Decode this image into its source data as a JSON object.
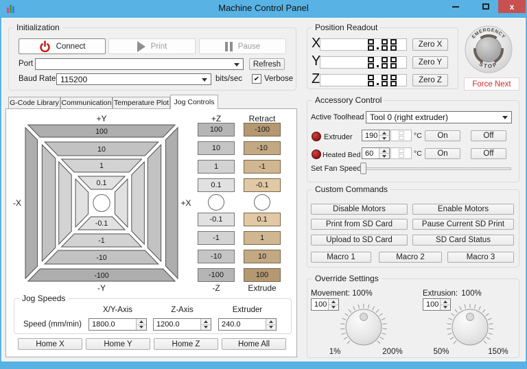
{
  "window": {
    "title": "Machine Control Panel",
    "close_glyph": "x"
  },
  "init": {
    "title": "Initialization",
    "connect": "Connect",
    "print": "Print",
    "pause": "Pause",
    "port_label": "Port",
    "port_value": "",
    "refresh": "Refresh",
    "baud_label": "Baud Rate",
    "baud_value": "115200",
    "bits_sec": "bits/sec",
    "verbose": "Verbose",
    "verbose_checked": "✔"
  },
  "tabs": [
    "G-Code Library",
    "Communication",
    "Temperature Plot",
    "Jog Controls"
  ],
  "jog": {
    "plus_y": "+Y",
    "minus_y": "-Y",
    "minus_x": "-X",
    "plus_x": "+X",
    "plus_z": "+Z",
    "minus_z": "-Z",
    "retract": "Retract",
    "extrude": "Extrude",
    "xy_top": [
      "100",
      "10",
      "1",
      "0.1"
    ],
    "xy_bottom": [
      "-0.1",
      "-1",
      "-10",
      "-100"
    ],
    "z_top": [
      "100",
      "10",
      "1",
      "0.1"
    ],
    "z_bottom": [
      "-0.1",
      "-1",
      "-10",
      "-100"
    ],
    "e_top": [
      "-100",
      "-10",
      "-1",
      "-0.1"
    ],
    "e_bottom": [
      "0.1",
      "1",
      "10",
      "100"
    ]
  },
  "jog_speeds": {
    "title": "Jog Speeds",
    "row_label": "Speed (mm/min)",
    "columns": [
      "X/Y-Axis",
      "Z-Axis",
      "Extruder"
    ],
    "values": [
      "1800.0",
      "1200.0",
      "240.0"
    ]
  },
  "home": [
    "Home X",
    "Home Y",
    "Home Z",
    "Home All"
  ],
  "position": {
    "title": "Position Readout",
    "axes": [
      {
        "label": "X",
        "value": "0.00",
        "zero": "Zero X"
      },
      {
        "label": "Y",
        "value": "0.00",
        "zero": "Zero Y"
      },
      {
        "label": "Z",
        "value": "0.00",
        "zero": "Zero Z"
      }
    ],
    "estop_line1": "EMERGENCY",
    "estop_line2": "STOP",
    "force_next": "Force Next"
  },
  "accessory": {
    "title": "Accessory Control",
    "toolhead_label": "Active Toolhead",
    "toolhead_value": "Tool 0 (right extruder)",
    "rows": [
      {
        "name": "Extruder",
        "setpoint": "190",
        "reading": "0",
        "unit": "°C",
        "on": "On",
        "off": "Off"
      },
      {
        "name": "Heated Bed",
        "setpoint": "60",
        "reading": "0",
        "unit": "°C",
        "on": "On",
        "off": "Off"
      }
    ],
    "fan_label": "Set Fan Speed"
  },
  "custom": {
    "title": "Custom Commands",
    "buttons": [
      "Disable Motors",
      "Enable Motors",
      "Print from SD Card",
      "Pause Current SD Print",
      "Upload to SD Card",
      "SD Card Status",
      "Macro 1",
      "Macro 2",
      "Macro 3"
    ]
  },
  "override": {
    "title": "Override Settings",
    "movement": {
      "label": "Movement:",
      "value": "100",
      "current": "100%",
      "min": "1%",
      "max": "200%"
    },
    "extrusion": {
      "label": "Extrusion:",
      "value": "100",
      "current": "100%",
      "min": "50%",
      "max": "150%"
    }
  },
  "colors": {
    "titlebar": "#58b2e4",
    "close_button": "#c75050",
    "force_next_text": "#d42a2a",
    "connect_icon": "#cc2020",
    "led": "#8e1515",
    "retract_button": "#c3a983"
  }
}
